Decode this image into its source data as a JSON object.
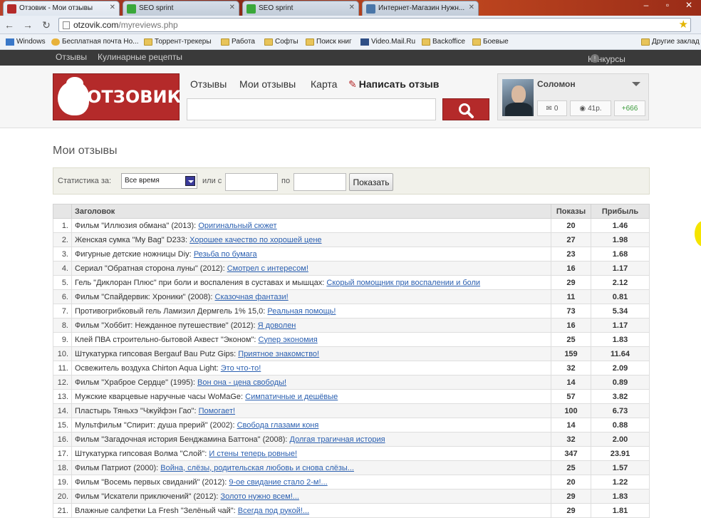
{
  "browser": {
    "tabs": [
      {
        "title": "Отзовик - Мои отзывы",
        "fav": "#b42a2a"
      },
      {
        "title": "SEO sprint",
        "fav": "#3aa83a"
      },
      {
        "title": "SEO sprint",
        "fav": "#3aa83a"
      },
      {
        "title": "Интернет-Магазин Нужн...",
        "fav": "#4a76a8"
      }
    ],
    "url_host": "otzovik.com",
    "url_path": "/myreviews.php",
    "bookmarks": [
      {
        "label": "Windows",
        "icon": "windows-icon"
      },
      {
        "label": "Бесплатная почта Но...",
        "icon": "mail-icon"
      },
      {
        "label": "Торрент-трекеры",
        "icon": "folder-icon"
      },
      {
        "label": "Работа",
        "icon": "folder-icon"
      },
      {
        "label": "Софты",
        "icon": "folder-icon"
      },
      {
        "label": "Поиск книг",
        "icon": "folder-icon"
      },
      {
        "label": "Video.Mail.Ru",
        "icon": "video-icon"
      },
      {
        "label": "Backoffice",
        "icon": "folder-icon"
      },
      {
        "label": "Боевые",
        "icon": "folder-icon"
      },
      {
        "label": "Другие заклад",
        "icon": "folder-icon"
      }
    ]
  },
  "site": {
    "topnav": {
      "reviews": "Отзывы",
      "recipes": "Кулинарные рецепты",
      "contests": "Конкурсы",
      "info": "!"
    },
    "logo": "ОТЗОВИК",
    "nav": {
      "reviews": "Отзывы",
      "my_reviews": "Мои отзывы",
      "map": "Карта",
      "write": "Написать отзыв"
    },
    "search": {
      "placeholder": ""
    },
    "user": {
      "name": "Соломон",
      "messages": "0",
      "rating": "41р.",
      "karma": "+666"
    }
  },
  "page": {
    "title": "Мои отзывы",
    "filter": {
      "stats_label": "Статистика за:",
      "period": "Все время",
      "from_label": "или с",
      "to_label": "по",
      "show_button": "Показать"
    },
    "table": {
      "headers": {
        "title": "Заголовок",
        "views": "Показы",
        "profit": "Прибыль"
      },
      "rows": [
        {
          "n": "1.",
          "item": "Фильм \"Иллюзия обмана\" (2013):",
          "review": "Оригинальный сюжет",
          "views": "20",
          "profit": "1.46"
        },
        {
          "n": "2.",
          "item": "Женская сумка \"My Bag\" D233:",
          "review": "Хорошее качество по хорошей цене",
          "views": "27",
          "profit": "1.98"
        },
        {
          "n": "3.",
          "item": "Фигурные детские ножницы Diy:",
          "review": "Резьба по бумага",
          "views": "23",
          "profit": "1.68"
        },
        {
          "n": "4.",
          "item": "Сериал \"Обратная сторона луны\" (2012):",
          "review": "Смотрел с интересом!",
          "views": "16",
          "profit": "1.17"
        },
        {
          "n": "5.",
          "item": "Гель \"Диклоран Плюс\" при боли и воспаления в суставах и мышцах:",
          "review": "Скорый помощник при воспалении и боли",
          "views": "29",
          "profit": "2.12"
        },
        {
          "n": "6.",
          "item": "Фильм \"Спайдервик: Хроники\" (2008):",
          "review": "Сказочная фантази!",
          "views": "11",
          "profit": "0.81"
        },
        {
          "n": "7.",
          "item": "Противогрибковый гель Ламизил Дермгель 1% 15,0:",
          "review": "Реальная помощь!",
          "views": "73",
          "profit": "5.34"
        },
        {
          "n": "8.",
          "item": "Фильм \"Хоббит: Нежданное путешествие\" (2012):",
          "review": "Я доволен",
          "views": "16",
          "profit": "1.17"
        },
        {
          "n": "9.",
          "item": "Клей ПВА строительно-бытовой Аквест \"Эконом\":",
          "review": "Супер экономия",
          "views": "25",
          "profit": "1.83"
        },
        {
          "n": "10.",
          "item": "Штукатурка гипсовая Bergauf Bau Putz Gips:",
          "review": "Приятное знакомство!",
          "views": "159",
          "profit": "11.64"
        },
        {
          "n": "11.",
          "item": "Освежитель воздуха Chirton Aqua Light:",
          "review": "Это что-то!",
          "views": "32",
          "profit": "2.09"
        },
        {
          "n": "12.",
          "item": "Фильм \"Храброе Сердце\" (1995):",
          "review": "Вон она - цена свободы!",
          "views": "14",
          "profit": "0.89"
        },
        {
          "n": "13.",
          "item": "Мужские кварцевые наручные часы WoMaGe:",
          "review": "Симпатичные и дешёвые",
          "views": "57",
          "profit": "3.82"
        },
        {
          "n": "14.",
          "item": "Пластырь Тяньхэ \"Чжуйфэн Гао\":",
          "review": "Помогает!",
          "views": "100",
          "profit": "6.73"
        },
        {
          "n": "15.",
          "item": "Мультфильм \"Спирит: душа прерий\" (2002):",
          "review": "Свобода глазами коня",
          "views": "14",
          "profit": "0.88"
        },
        {
          "n": "16.",
          "item": "Фильм \"Загадочная история Бенджамина Баттона\" (2008):",
          "review": "Долгая трагичная история",
          "views": "32",
          "profit": "2.00"
        },
        {
          "n": "17.",
          "item": "Штукатурка гипсовая Волма \"Слой\":",
          "review": "И стены теперь ровные!",
          "views": "347",
          "profit": "23.91"
        },
        {
          "n": "18.",
          "item": "Фильм Патриот (2000):",
          "review": "Война, слёзы, родительская любовь и снова слёзы...",
          "views": "25",
          "profit": "1.57"
        },
        {
          "n": "19.",
          "item": "Фильм \"Восемь первых свиданий\" (2012):",
          "review": "9-ое свидание стало 2-м!...",
          "views": "20",
          "profit": "1.22"
        },
        {
          "n": "20.",
          "item": "Фильм \"Искатели приключений\" (2012):",
          "review": "Золото нужно всем!...",
          "views": "29",
          "profit": "1.83"
        },
        {
          "n": "21.",
          "item": "Влажные салфетки La Fresh \"Зелёный чай\":",
          "review": "Всегда под рукой!...",
          "views": "29",
          "profit": "1.81"
        }
      ]
    }
  }
}
